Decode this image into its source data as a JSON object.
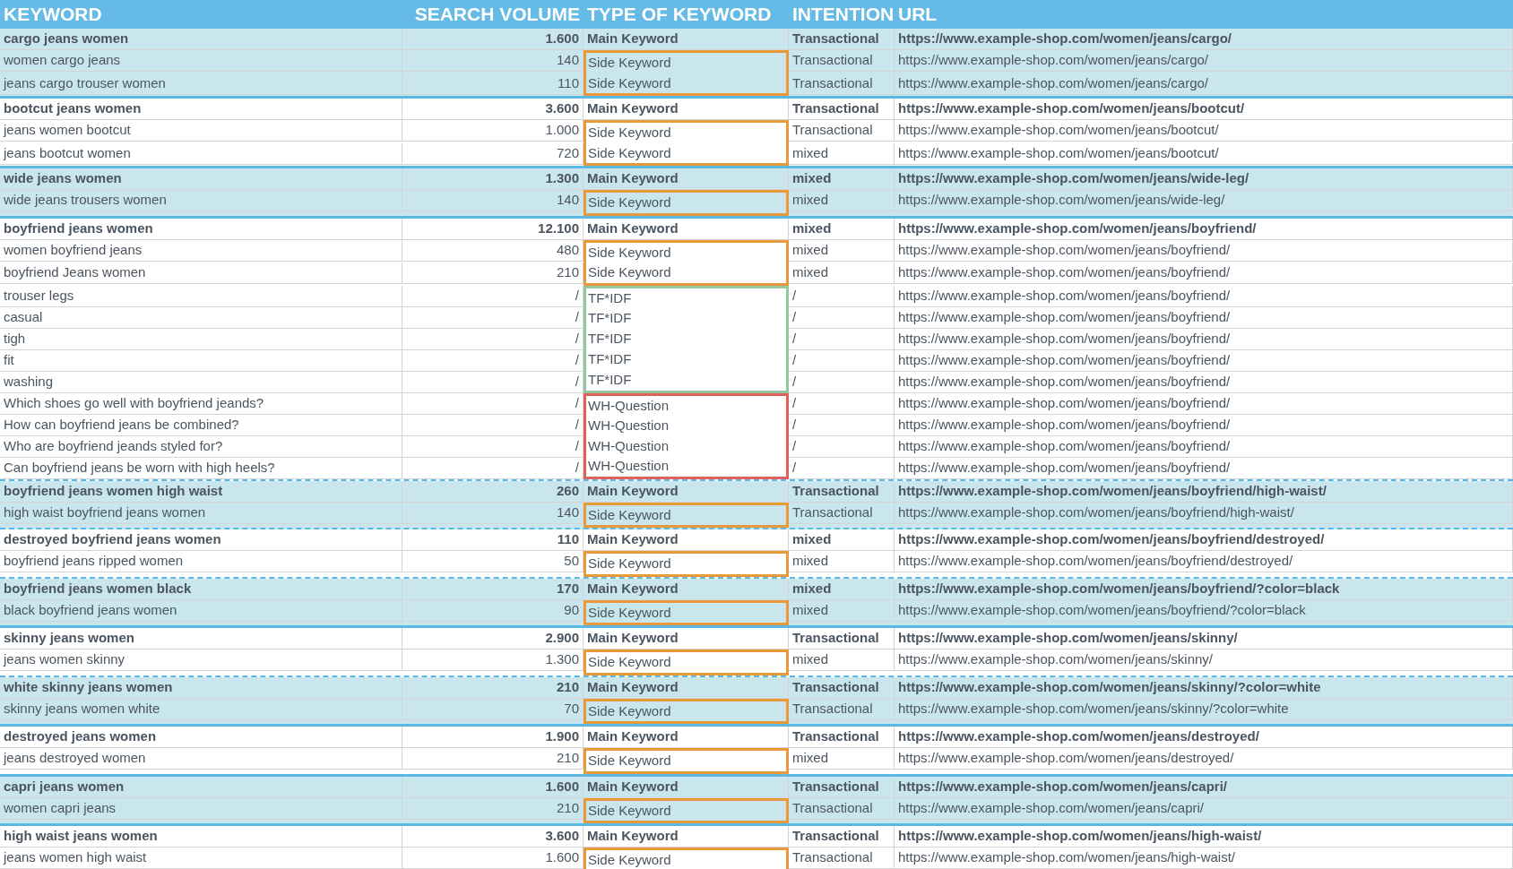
{
  "columns": [
    "KEYWORD",
    "SEARCH VOLUME",
    "TYPE OF KEYWORD",
    "INTENTION",
    "URL"
  ],
  "groups": [
    {
      "shaded": true,
      "divider_below": true,
      "divider_dashed": false,
      "rows": [
        {
          "kind": "main",
          "keyword": "cargo jeans women",
          "volume": "1.600",
          "type": "Main Keyword",
          "intention": "Transactional",
          "url": "https://www.example-shop.com/women/jeans/cargo/"
        },
        {
          "kind": "side",
          "keyword": "women cargo jeans",
          "volume": "140",
          "type": "Side Keyword",
          "intention": "Transactional",
          "url": "https://www.example-shop.com/women/jeans/cargo/"
        },
        {
          "kind": "side",
          "keyword": "jeans cargo trouser women",
          "volume": "110",
          "type": "Side Keyword",
          "intention": "Transactional",
          "url": "https://www.example-shop.com/women/jeans/cargo/"
        }
      ]
    },
    {
      "shaded": false,
      "divider_below": true,
      "divider_dashed": false,
      "rows": [
        {
          "kind": "main",
          "keyword": "bootcut jeans women",
          "volume": "3.600",
          "type": "Main Keyword",
          "intention": "Transactional",
          "url": "https://www.example-shop.com/women/jeans/bootcut/"
        },
        {
          "kind": "side",
          "keyword": "jeans women bootcut",
          "volume": "1.000",
          "type": "Side Keyword",
          "intention": "Transactional",
          "url": "https://www.example-shop.com/women/jeans/bootcut/"
        },
        {
          "kind": "side",
          "keyword": "jeans bootcut women",
          "volume": "720",
          "type": "Side Keyword",
          "intention": "mixed",
          "url": "https://www.example-shop.com/women/jeans/bootcut/"
        }
      ]
    },
    {
      "shaded": true,
      "divider_below": true,
      "divider_dashed": false,
      "rows": [
        {
          "kind": "main",
          "keyword": "wide jeans women",
          "volume": "1.300",
          "type": "Main Keyword",
          "intention": "mixed",
          "url": "https://www.example-shop.com/women/jeans/wide-leg/"
        },
        {
          "kind": "side",
          "keyword": "wide jeans trousers women",
          "volume": "140",
          "type": "Side Keyword",
          "intention": "mixed",
          "url": "https://www.example-shop.com/women/jeans/wide-leg/"
        }
      ]
    },
    {
      "shaded": false,
      "divider_below": true,
      "divider_dashed": true,
      "rows": [
        {
          "kind": "main",
          "keyword": "boyfriend jeans women",
          "volume": "12.100",
          "type": "Main Keyword",
          "intention": "mixed",
          "url": "https://www.example-shop.com/women/jeans/boyfriend/"
        },
        {
          "kind": "side",
          "keyword": "women boyfriend jeans",
          "volume": "480",
          "type": "Side Keyword",
          "intention": "mixed",
          "url": "https://www.example-shop.com/women/jeans/boyfriend/"
        },
        {
          "kind": "side",
          "keyword": "boyfriend Jeans women",
          "volume": "210",
          "type": "Side Keyword",
          "intention": "mixed",
          "url": "https://www.example-shop.com/women/jeans/boyfriend/"
        },
        {
          "kind": "tfidf",
          "keyword": "trouser legs",
          "volume": "/",
          "type": "TF*IDF",
          "intention": "/",
          "url": "https://www.example-shop.com/women/jeans/boyfriend/"
        },
        {
          "kind": "tfidf",
          "keyword": "casual",
          "volume": "/",
          "type": "TF*IDF",
          "intention": "/",
          "url": "https://www.example-shop.com/women/jeans/boyfriend/"
        },
        {
          "kind": "tfidf",
          "keyword": "tigh",
          "volume": "/",
          "type": "TF*IDF",
          "intention": "/",
          "url": "https://www.example-shop.com/women/jeans/boyfriend/"
        },
        {
          "kind": "tfidf",
          "keyword": "fit",
          "volume": "/",
          "type": "TF*IDF",
          "intention": "/",
          "url": "https://www.example-shop.com/women/jeans/boyfriend/"
        },
        {
          "kind": "tfidf",
          "keyword": "washing",
          "volume": "/",
          "type": "TF*IDF",
          "intention": "/",
          "url": "https://www.example-shop.com/women/jeans/boyfriend/"
        },
        {
          "kind": "question",
          "keyword": "Which shoes go well with boyfriend jeands?",
          "volume": "/",
          "type": "WH-Question",
          "intention": "/",
          "url": "https://www.example-shop.com/women/jeans/boyfriend/"
        },
        {
          "kind": "question",
          "keyword": "How can boyfriend jeans be combined?",
          "volume": "/",
          "type": "WH-Question",
          "intention": "/",
          "url": "https://www.example-shop.com/women/jeans/boyfriend/"
        },
        {
          "kind": "question",
          "keyword": "Who are boyfriend jeands styled for?",
          "volume": "/",
          "type": "WH-Question",
          "intention": "/",
          "url": "https://www.example-shop.com/women/jeans/boyfriend/"
        },
        {
          "kind": "question",
          "keyword": "Can boyfriend jeans be worn with high heels?",
          "volume": "/",
          "type": "WH-Question",
          "intention": "/",
          "url": "https://www.example-shop.com/women/jeans/boyfriend/"
        }
      ]
    },
    {
      "shaded": true,
      "divider_below": true,
      "divider_dashed": true,
      "rows": [
        {
          "kind": "main",
          "keyword": "boyfriend jeans women high waist",
          "volume": "260",
          "type": "Main Keyword",
          "intention": "Transactional",
          "url": "https://www.example-shop.com/women/jeans/boyfriend/high-waist/"
        },
        {
          "kind": "side",
          "keyword": "high waist boyfriend jeans women",
          "volume": "140",
          "type": "Side Keyword",
          "intention": "Transactional",
          "url": "https://www.example-shop.com/women/jeans/boyfriend/high-waist/"
        }
      ]
    },
    {
      "shaded": false,
      "divider_below": true,
      "divider_dashed": true,
      "rows": [
        {
          "kind": "main",
          "keyword": "destroyed boyfriend jeans women",
          "volume": "110",
          "type": "Main Keyword",
          "intention": "mixed",
          "url": "https://www.example-shop.com/women/jeans/boyfriend/destroyed/"
        },
        {
          "kind": "side",
          "keyword": "boyfriend jeans ripped women",
          "volume": "50",
          "type": "Side Keyword",
          "intention": "mixed",
          "url": "https://www.example-shop.com/women/jeans/boyfriend/destroyed/"
        }
      ]
    },
    {
      "shaded": true,
      "divider_below": true,
      "divider_dashed": false,
      "rows": [
        {
          "kind": "main",
          "keyword": "boyfriend jeans women black",
          "volume": "170",
          "type": "Main Keyword",
          "intention": "mixed",
          "url": "https://www.example-shop.com/women/jeans/boyfriend/?color=black"
        },
        {
          "kind": "side",
          "keyword": "black boyfriend jeans women",
          "volume": "90",
          "type": "Side Keyword",
          "intention": "mixed",
          "url": "https://www.example-shop.com/women/jeans/boyfriend/?color=black"
        }
      ]
    },
    {
      "shaded": false,
      "divider_below": true,
      "divider_dashed": true,
      "rows": [
        {
          "kind": "main",
          "keyword": "skinny jeans women",
          "volume": "2.900",
          "type": "Main Keyword",
          "intention": "Transactional",
          "url": "https://www.example-shop.com/women/jeans/skinny/"
        },
        {
          "kind": "side",
          "keyword": "jeans women skinny",
          "volume": "1.300",
          "type": "Side Keyword",
          "intention": "mixed",
          "url": "https://www.example-shop.com/women/jeans/skinny/"
        }
      ]
    },
    {
      "shaded": true,
      "divider_below": true,
      "divider_dashed": false,
      "rows": [
        {
          "kind": "main",
          "keyword": "white skinny jeans women",
          "volume": "210",
          "type": "Main Keyword",
          "intention": "Transactional",
          "url": "https://www.example-shop.com/women/jeans/skinny/?color=white"
        },
        {
          "kind": "side",
          "keyword": "skinny jeans women white",
          "volume": "70",
          "type": "Side Keyword",
          "intention": "Transactional",
          "url": "https://www.example-shop.com/women/jeans/skinny/?color=white"
        }
      ]
    },
    {
      "shaded": false,
      "divider_below": true,
      "divider_dashed": false,
      "rows": [
        {
          "kind": "main",
          "keyword": "destroyed jeans women",
          "volume": "1.900",
          "type": "Main Keyword",
          "intention": "Transactional",
          "url": "https://www.example-shop.com/women/jeans/destroyed/"
        },
        {
          "kind": "side",
          "keyword": "jeans destroyed women",
          "volume": "210",
          "type": "Side Keyword",
          "intention": "mixed",
          "url": "https://www.example-shop.com/women/jeans/destroyed/"
        }
      ]
    },
    {
      "shaded": true,
      "divider_below": true,
      "divider_dashed": false,
      "rows": [
        {
          "kind": "main",
          "keyword": "capri jeans women",
          "volume": "1.600",
          "type": "Main Keyword",
          "intention": "Transactional",
          "url": "https://www.example-shop.com/women/jeans/capri/"
        },
        {
          "kind": "side",
          "keyword": "women capri jeans",
          "volume": "210",
          "type": "Side Keyword",
          "intention": "Transactional",
          "url": "https://www.example-shop.com/women/jeans/capri/"
        }
      ]
    },
    {
      "shaded": false,
      "divider_below": false,
      "rows": [
        {
          "kind": "main",
          "keyword": "high waist jeans women",
          "volume": "3.600",
          "type": "Main Keyword",
          "intention": "Transactional",
          "url": "https://www.example-shop.com/women/jeans/high-waist/"
        },
        {
          "kind": "side",
          "keyword": "jeans women high waist",
          "volume": "1.600",
          "type": "Side Keyword",
          "intention": "Transactional",
          "url": "https://www.example-shop.com/women/jeans/high-waist/"
        }
      ]
    }
  ]
}
